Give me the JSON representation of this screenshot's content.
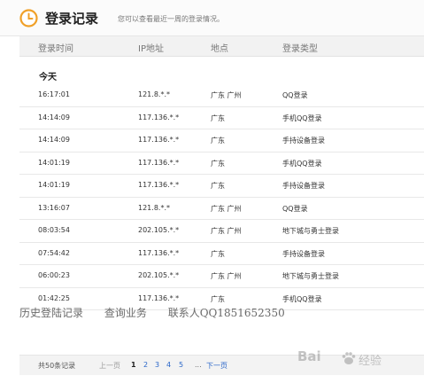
{
  "header": {
    "title": "登录记录",
    "subtitle": "您可以查看最近一周的登录情况。",
    "icon": "clock-icon",
    "accent": "#f0a028"
  },
  "columns": [
    "登录时间",
    "IP地址",
    "地点",
    "登录类型"
  ],
  "section": "今天",
  "rows": [
    {
      "time": "16:17:01",
      "ip": "121.8.*.*",
      "place": "广东 广州",
      "type": "QQ登录"
    },
    {
      "time": "14:14:09",
      "ip": "117.136.*.*",
      "place": "广东",
      "type": "手机QQ登录"
    },
    {
      "time": "14:14:09",
      "ip": "117.136.*.*",
      "place": "广东",
      "type": "手持设备登录"
    },
    {
      "time": "14:01:19",
      "ip": "117.136.*.*",
      "place": "广东",
      "type": "手机QQ登录"
    },
    {
      "time": "14:01:19",
      "ip": "117.136.*.*",
      "place": "广东",
      "type": "手持设备登录"
    },
    {
      "time": "13:16:07",
      "ip": "121.8.*.*",
      "place": "广东 广州",
      "type": "QQ登录"
    },
    {
      "time": "08:03:54",
      "ip": "202.105.*.*",
      "place": "广东 广州",
      "type": "地下城与勇士登录"
    },
    {
      "time": "07:54:42",
      "ip": "117.136.*.*",
      "place": "广东",
      "type": "手持设备登录"
    },
    {
      "time": "06:00:23",
      "ip": "202.105.*.*",
      "place": "广东 广州",
      "type": "地下城与勇士登录"
    },
    {
      "time": "01:42:25",
      "ip": "117.136.*.*",
      "place": "广东",
      "type": "手机QQ登录"
    }
  ],
  "overlay": {
    "part1": "历史登陆记录",
    "part2": "查询业务",
    "part3": "联系人QQ1851652350"
  },
  "pager": {
    "total": "共50条记录",
    "prev": "上一页",
    "pages": [
      "1",
      "2",
      "3",
      "4",
      "5"
    ],
    "ellipsis": "...",
    "next": "下一页"
  },
  "watermark": {
    "text": "Bai",
    "suffix": "经验",
    "icon": "paw-icon"
  }
}
